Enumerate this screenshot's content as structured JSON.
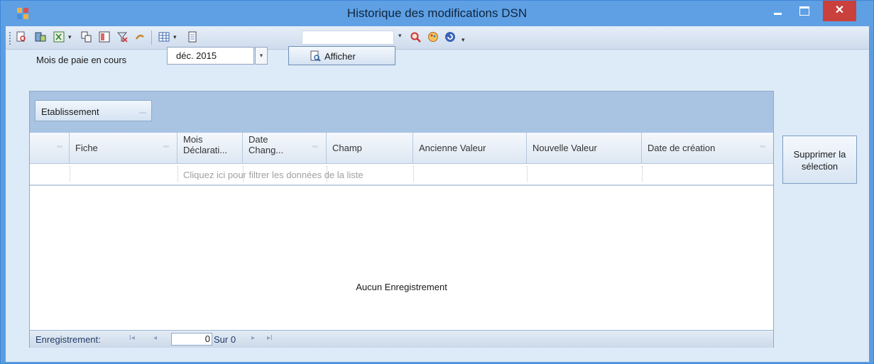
{
  "window": {
    "title": "Historique des modifications DSN",
    "close_glyph": "✕",
    "accent_color": "#5ea0e3"
  },
  "toolbar": {
    "icons": [
      "print-preview-icon",
      "export-icon",
      "excel-icon",
      "copy-icon",
      "columns-icon",
      "filter-clear-icon",
      "refresh-arrow-icon",
      "grid-layout-icon",
      "page-icon",
      "search-icon",
      "palette-icon",
      "reload-icon"
    ],
    "combo_value": "",
    "dropdown_glyph": "▾"
  },
  "filter": {
    "mois_label": "Mois de paie en cours",
    "mois_value": "déc. 2015",
    "mois_arrow": "▾",
    "afficher_label": "Afficher"
  },
  "grid": {
    "group_chip": "Etablissement",
    "columns": [
      "Fiche",
      "Mois Déclarati...",
      "Date Chang...",
      "Champ",
      "Ancienne Valeur",
      "Nouvelle Valeur",
      "Date de création"
    ],
    "filter_placeholder": "Cliquez ici pour filtrer les données de la liste",
    "empty_message": "Aucun Enregistrement",
    "rows": []
  },
  "navigator": {
    "label": "Enregistrement:",
    "first": "I◂",
    "prev": "◂",
    "current": "0",
    "of_text": "Sur 0",
    "next": "▸",
    "last": "▸I"
  },
  "actions": {
    "delete_label": "Supprimer la sélection"
  }
}
